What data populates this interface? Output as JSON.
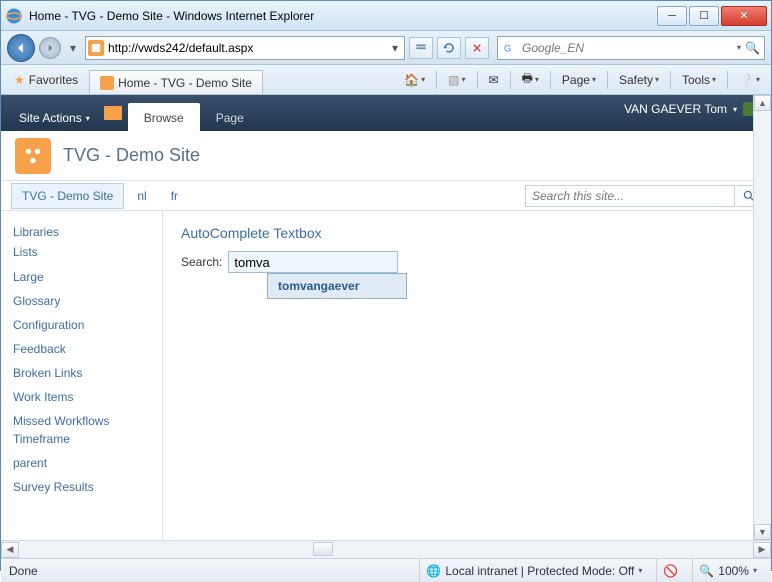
{
  "window": {
    "title": "Home - TVG - Demo Site - Windows Internet Explorer"
  },
  "address": {
    "url": "http://vwds242/default.aspx"
  },
  "browser_search": {
    "placeholder": "Google_EN"
  },
  "favorites_label": "Favorites",
  "tab_title": "Home - TVG - Demo Site",
  "ie_menu": {
    "page": "Page",
    "safety": "Safety",
    "tools": "Tools"
  },
  "sp": {
    "site_actions": "Site Actions",
    "tabs": {
      "browse": "Browse",
      "page": "Page"
    },
    "user": "VAN GAEVER Tom",
    "site_title": "TVG - Demo Site",
    "topnav": {
      "home": "TVG - Demo Site",
      "nl": "nl",
      "fr": "fr"
    },
    "site_search_placeholder": "Search this site...",
    "leftnav": {
      "libraries": "Libraries",
      "lists": "Lists",
      "items": [
        "Large",
        "Glossary",
        "Configuration",
        "Feedback",
        "Broken Links",
        "Work Items",
        "Missed Workflows Timeframe",
        "parent",
        "Survey Results"
      ]
    },
    "webpart_title": "AutoComplete Textbox",
    "search_label": "Search:",
    "search_value": "tomva",
    "suggestion": "tomvangaever"
  },
  "status": {
    "done": "Done",
    "zone": "Local intranet | Protected Mode: Off",
    "zoom": "100%"
  }
}
